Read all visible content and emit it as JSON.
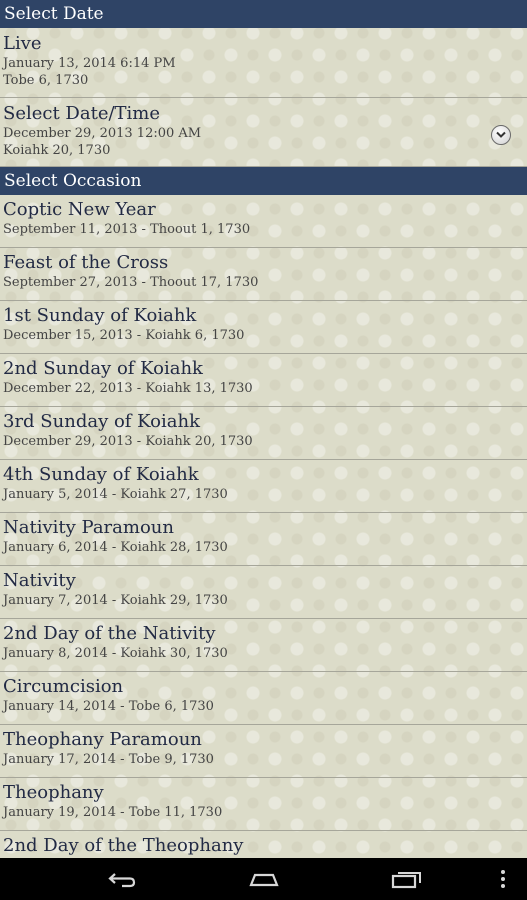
{
  "select_date": {
    "header": "Select Date",
    "live": {
      "title": "Live",
      "gregorian": "January 13, 2014 6:14 PM",
      "coptic": "Tobe 6, 1730"
    },
    "select": {
      "title": "Select Date/Time",
      "gregorian": "December 29, 2013 12:00 AM",
      "coptic": "Koiahk 20, 1730",
      "icon": "chevron-down-circle-icon"
    }
  },
  "select_occasion": {
    "header": "Select Occasion",
    "items": [
      {
        "name": "Coptic New Year",
        "date": "September 11, 2013 - Thoout 1, 1730"
      },
      {
        "name": "Feast of the Cross",
        "date": "September 27, 2013 - Thoout 17, 1730"
      },
      {
        "name": "1st Sunday of Koiahk",
        "date": "December 15, 2013 - Koiahk 6, 1730"
      },
      {
        "name": "2nd Sunday of Koiahk",
        "date": "December 22, 2013 - Koiahk 13, 1730"
      },
      {
        "name": "3rd Sunday of Koiahk",
        "date": "December 29, 2013 - Koiahk 20, 1730"
      },
      {
        "name": "4th Sunday of Koiahk",
        "date": "January 5, 2014 - Koiahk 27, 1730"
      },
      {
        "name": "Nativity Paramoun",
        "date": "January 6, 2014 - Koiahk 28, 1730"
      },
      {
        "name": "Nativity",
        "date": "January 7, 2014 - Koiahk 29, 1730"
      },
      {
        "name": "2nd Day of the Nativity",
        "date": "January 8, 2014 - Koiahk 30, 1730"
      },
      {
        "name": "Circumcision",
        "date": "January 14, 2014 - Tobe 6, 1730"
      },
      {
        "name": "Theophany Paramoun",
        "date": "January 17, 2014 - Tobe 9, 1730"
      },
      {
        "name": "Theophany",
        "date": "January 19, 2014 - Tobe 11, 1730"
      },
      {
        "name": "2nd Day of the Theophany",
        "date": ""
      }
    ]
  },
  "nav": {
    "back_icon": "back-icon",
    "home_icon": "home-icon",
    "recents_icon": "recent-apps-icon",
    "menu_icon": "overflow-menu-icon"
  },
  "colors": {
    "header_bg": "#2f4466",
    "background": "#dcdcc9",
    "title_text": "#222a44",
    "nav_bg": "#000000"
  }
}
